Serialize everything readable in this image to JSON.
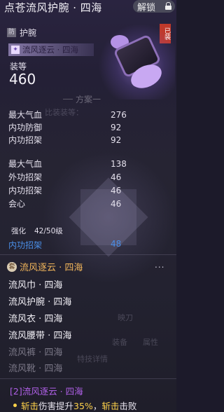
{
  "header": {
    "title": "点苍流风护腕 · 四海",
    "unlock_label": "解锁"
  },
  "item": {
    "slot_badge": "防",
    "slot_label": "护腕",
    "equipped_badge": "已装",
    "set_tag": "流风逐云 · 四海",
    "grade_label": "装等",
    "grade_value": "460"
  },
  "section_title": "方案一",
  "background_text": {
    "compare": "比装装等：",
    "tabs": [
      "映刀",
      "装备",
      "属性"
    ],
    "details": "特技详情"
  },
  "stats_group1": [
    {
      "name": "最大气血",
      "value": "276"
    },
    {
      "name": "内功防御",
      "value": "92"
    },
    {
      "name": "内功招架",
      "value": "92"
    }
  ],
  "stats_group2": [
    {
      "name": "最大气血",
      "value": "138"
    },
    {
      "name": "外功招架",
      "value": "46"
    },
    {
      "name": "内功招架",
      "value": "46"
    },
    {
      "name": "会心",
      "value": "46"
    }
  ],
  "refine": {
    "label": "强化",
    "level": "42/50级",
    "stat_name": "内功招架",
    "stat_value": "48"
  },
  "set": {
    "icon": "套",
    "name": "流风逐云 · 四海",
    "more": "...",
    "pieces": [
      {
        "name": "流风巾 · 四海",
        "owned": true
      },
      {
        "name": "流风护腕 · 四海",
        "owned": true
      },
      {
        "name": "流风衣 · 四海",
        "owned": true
      },
      {
        "name": "流风腰带 · 四海",
        "owned": true
      },
      {
        "name": "流风裤 · 四海",
        "owned": false
      },
      {
        "name": "流风靴 · 四海",
        "owned": false
      }
    ],
    "bonus_title": "[2]流风逐云 · 四海",
    "bonus_part1": "斩击",
    "bonus_part2": "伤害提升",
    "bonus_pct": "35%",
    "bonus_part3": "，",
    "bonus_part4": "斩击",
    "bonus_part5": "击败"
  },
  "colors": {
    "set_name": "#f0b45a",
    "refine": "#4a8fe8",
    "bonus_title": "#b060e8",
    "highlight": "#ffd24a",
    "equipped": "#c0392b"
  }
}
